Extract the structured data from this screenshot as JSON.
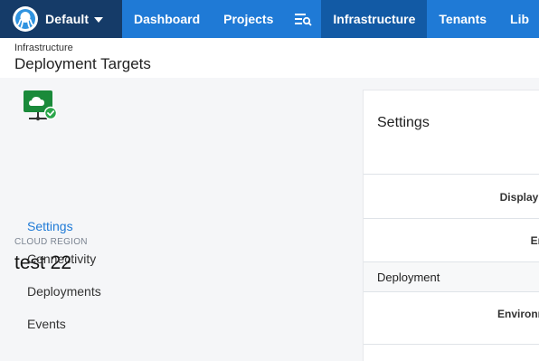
{
  "topnav": {
    "space_name": "Default",
    "items": [
      {
        "label": "Dashboard"
      },
      {
        "label": "Projects"
      },
      {
        "label": "Infrastructure"
      },
      {
        "label": "Tenants"
      },
      {
        "label": "Lib"
      }
    ]
  },
  "header": {
    "breadcrumb": "Infrastructure",
    "title": "Deployment Targets"
  },
  "target": {
    "type_label": "CLOUD REGION",
    "name": "test 22",
    "icon": "cloud-region-icon"
  },
  "sidebar": {
    "links": [
      {
        "label": "Settings"
      },
      {
        "label": "Connectivity"
      },
      {
        "label": "Deployments"
      },
      {
        "label": "Events"
      }
    ]
  },
  "panel": {
    "title": "Settings",
    "rows": [
      {
        "label": "Display I"
      },
      {
        "label": "En"
      }
    ],
    "section": "Deployment",
    "section_rows": [
      {
        "label": "Environn"
      }
    ]
  },
  "colors": {
    "nav_bg": "#1f7ad6",
    "nav_active": "#125aa5",
    "space_bg": "#153b68",
    "link_active": "#1f7ad6",
    "icon_green": "#1a8a3a"
  }
}
